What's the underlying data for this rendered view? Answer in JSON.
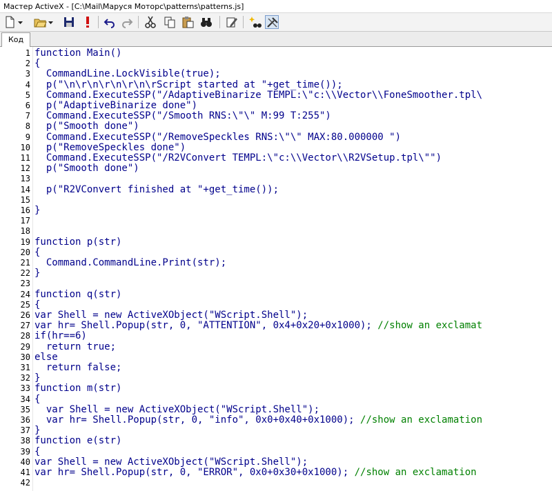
{
  "window": {
    "title": "Мастер ActiveX - [C:\\Mail\\Маруся Моторс\\patterns\\patterns.js]"
  },
  "toolbar": {
    "buttons": [
      {
        "icon": "new-document-icon"
      },
      {
        "icon": "open-folder-icon"
      },
      {
        "icon": "save-icon"
      },
      {
        "icon": "exclamation-icon"
      },
      {
        "icon": "undo-icon"
      },
      {
        "icon": "redo-icon"
      },
      {
        "icon": "cut-icon"
      },
      {
        "icon": "copy-icon"
      },
      {
        "icon": "paste-icon"
      },
      {
        "icon": "find-icon"
      },
      {
        "icon": "edit-icon"
      },
      {
        "icon": "wizard-icon"
      },
      {
        "icon": "tools-icon"
      }
    ]
  },
  "tabs": [
    {
      "label": "Код"
    }
  ],
  "colors": {
    "code": "#00008b",
    "comment": "#008000",
    "line_number": "#000000"
  },
  "code_lines": [
    {
      "number": "1",
      "text": "function Main()",
      "comment": ""
    },
    {
      "number": "2",
      "text": "{",
      "comment": ""
    },
    {
      "number": "3",
      "text": "  CommandLine.LockVisible(true);",
      "comment": ""
    },
    {
      "number": "4",
      "text": "  p(\"\\n\\r\\n\\r\\n\\r\\n\\rScript started at \"+get_time());",
      "comment": ""
    },
    {
      "number": "5",
      "text": "  Command.ExecuteSSP(\"/AdaptiveBinarize TEMPL:\\\"c:\\\\Vector\\\\FoneSmoother.tpl\\",
      "comment": ""
    },
    {
      "number": "6",
      "text": "  p(\"AdaptiveBinarize done\")",
      "comment": ""
    },
    {
      "number": "7",
      "text": "  Command.ExecuteSSP(\"/Smooth RNS:\\\"\\\" M:99 T:255\")",
      "comment": ""
    },
    {
      "number": "8",
      "text": "  p(\"Smooth done\")",
      "comment": ""
    },
    {
      "number": "9",
      "text": "  Command.ExecuteSSP(\"/RemoveSpeckles RNS:\\\"\\\" MAX:80.000000 \")",
      "comment": ""
    },
    {
      "number": "10",
      "text": "  p(\"RemoveSpeckles done\")",
      "comment": ""
    },
    {
      "number": "11",
      "text": "  Command.ExecuteSSP(\"/R2VConvert TEMPL:\\\"c:\\\\Vector\\\\R2VSetup.tpl\\\"\")",
      "comment": ""
    },
    {
      "number": "12",
      "text": "  p(\"Smooth done\")",
      "comment": ""
    },
    {
      "number": "13",
      "text": "",
      "comment": ""
    },
    {
      "number": "14",
      "text": "  p(\"R2VConvert finished at \"+get_time());",
      "comment": ""
    },
    {
      "number": "15",
      "text": "",
      "comment": ""
    },
    {
      "number": "16",
      "text": "}",
      "comment": ""
    },
    {
      "number": "17",
      "text": "",
      "comment": ""
    },
    {
      "number": "18",
      "text": "",
      "comment": ""
    },
    {
      "number": "19",
      "text": "function p(str)",
      "comment": ""
    },
    {
      "number": "20",
      "text": "{",
      "comment": ""
    },
    {
      "number": "21",
      "text": "  Command.CommandLine.Print(str);",
      "comment": ""
    },
    {
      "number": "22",
      "text": "}",
      "comment": ""
    },
    {
      "number": "23",
      "text": "",
      "comment": ""
    },
    {
      "number": "24",
      "text": "function q(str)",
      "comment": ""
    },
    {
      "number": "25",
      "text": "{",
      "comment": ""
    },
    {
      "number": "26",
      "text": "var Shell = new ActiveXObject(\"WScript.Shell\");",
      "comment": ""
    },
    {
      "number": "27",
      "text": "var hr= Shell.Popup(str, 0, \"ATTENTION\", 0x4+0x20+0x1000); ",
      "comment": "//show an exclamat"
    },
    {
      "number": "28",
      "text": "if(hr==6)",
      "comment": ""
    },
    {
      "number": "29",
      "text": "  return true;",
      "comment": ""
    },
    {
      "number": "30",
      "text": "else",
      "comment": ""
    },
    {
      "number": "31",
      "text": "  return false;",
      "comment": ""
    },
    {
      "number": "32",
      "text": "}",
      "comment": ""
    },
    {
      "number": "33",
      "text": "function m(str)",
      "comment": ""
    },
    {
      "number": "34",
      "text": "{",
      "comment": ""
    },
    {
      "number": "35",
      "text": "  var Shell = new ActiveXObject(\"WScript.Shell\");",
      "comment": ""
    },
    {
      "number": "36",
      "text": "  var hr= Shell.Popup(str, 0, \"info\", 0x0+0x40+0x1000); ",
      "comment": "//show an exclamation"
    },
    {
      "number": "37",
      "text": "}",
      "comment": ""
    },
    {
      "number": "38",
      "text": "function e(str)",
      "comment": ""
    },
    {
      "number": "39",
      "text": "{",
      "comment": ""
    },
    {
      "number": "40",
      "text": "var Shell = new ActiveXObject(\"WScript.Shell\");",
      "comment": ""
    },
    {
      "number": "41",
      "text": "var hr= Shell.Popup(str, 0, \"ERROR\", 0x0+0x30+0x1000); ",
      "comment": "//show an exclamation"
    },
    {
      "number": "42",
      "text": "",
      "comment": ""
    }
  ]
}
